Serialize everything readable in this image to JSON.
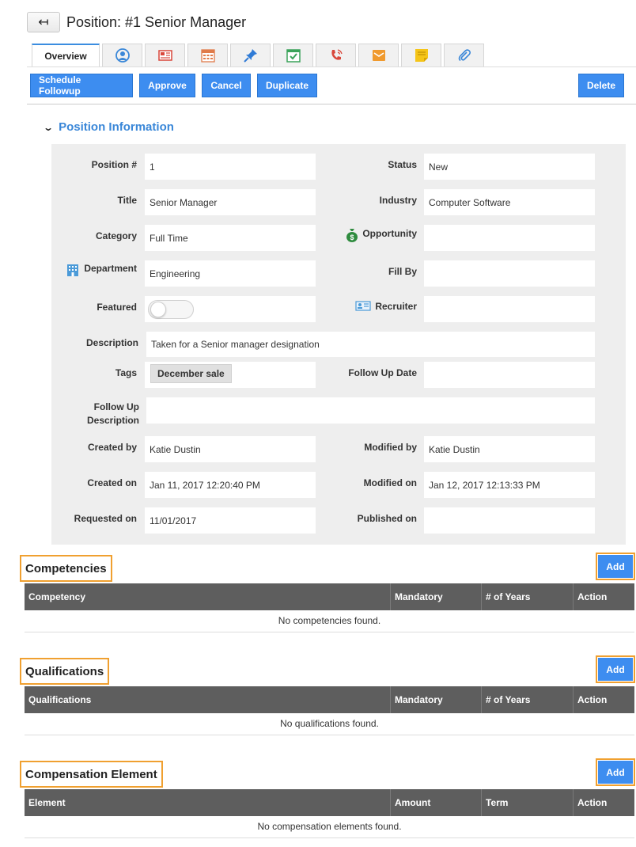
{
  "page": {
    "title": "Position: #1 Senior Manager"
  },
  "tabs": [
    {
      "label": "Overview",
      "icon": "overview"
    },
    {
      "icon": "contacts-icon"
    },
    {
      "icon": "newspaper-icon"
    },
    {
      "icon": "calendar-icon"
    },
    {
      "icon": "pin-icon"
    },
    {
      "icon": "task-icon"
    },
    {
      "icon": "phone-icon"
    },
    {
      "icon": "email-icon"
    },
    {
      "icon": "note-icon"
    },
    {
      "icon": "attachment-icon"
    }
  ],
  "toolbar": {
    "schedule_followup": "Schedule Followup",
    "approve": "Approve",
    "cancel": "Cancel",
    "duplicate": "Duplicate",
    "delete": "Delete"
  },
  "section": {
    "title": "Position Information"
  },
  "fields": {
    "position_no": {
      "label": "Position #",
      "value": "1"
    },
    "status": {
      "label": "Status",
      "value": "New"
    },
    "title": {
      "label": "Title",
      "value": "Senior Manager"
    },
    "industry": {
      "label": "Industry",
      "value": "Computer Software"
    },
    "category": {
      "label": "Category",
      "value": "Full Time"
    },
    "opportunity": {
      "label": "Opportunity",
      "value": ""
    },
    "department": {
      "label": "Department",
      "value": "Engineering"
    },
    "fill_by": {
      "label": "Fill By",
      "value": ""
    },
    "featured": {
      "label": "Featured",
      "value": false
    },
    "recruiter": {
      "label": "Recruiter",
      "value": ""
    },
    "description": {
      "label": "Description",
      "value": "Taken for a Senior manager designation"
    },
    "tags": {
      "label": "Tags",
      "value": "December sale"
    },
    "follow_up_date": {
      "label": "Follow Up Date",
      "value": ""
    },
    "follow_up_description": {
      "label_line1": "Follow Up",
      "label_line2": "Description",
      "value": ""
    },
    "created_by": {
      "label": "Created by",
      "value": "Katie Dustin"
    },
    "modified_by": {
      "label": "Modified by",
      "value": "Katie Dustin"
    },
    "created_on": {
      "label": "Created on",
      "value": "Jan 11, 2017 12:20:40 PM"
    },
    "modified_on": {
      "label": "Modified on",
      "value": "Jan 12, 2017 12:13:33 PM"
    },
    "requested_on": {
      "label": "Requested on",
      "value": "11/01/2017"
    },
    "published_on": {
      "label": "Published on",
      "value": ""
    }
  },
  "competencies": {
    "title": "Competencies",
    "add": "Add",
    "columns": [
      "Competency",
      "Mandatory",
      "# of Years",
      "Action"
    ],
    "empty": "No competencies found."
  },
  "qualifications": {
    "title": "Qualifications",
    "add": "Add",
    "columns": [
      "Qualifications",
      "Mandatory",
      "# of Years",
      "Action"
    ],
    "empty": "No qualifications found."
  },
  "compensation": {
    "title": "Compensation Element",
    "add": "Add",
    "columns": [
      "Element",
      "Amount",
      "Term",
      "Action"
    ],
    "empty": "No compensation elements found."
  },
  "colors": {
    "accent": "#3d8df0",
    "highlight": "#f0a030",
    "table_header": "#5e5e5e",
    "panel": "#eeeeee"
  }
}
